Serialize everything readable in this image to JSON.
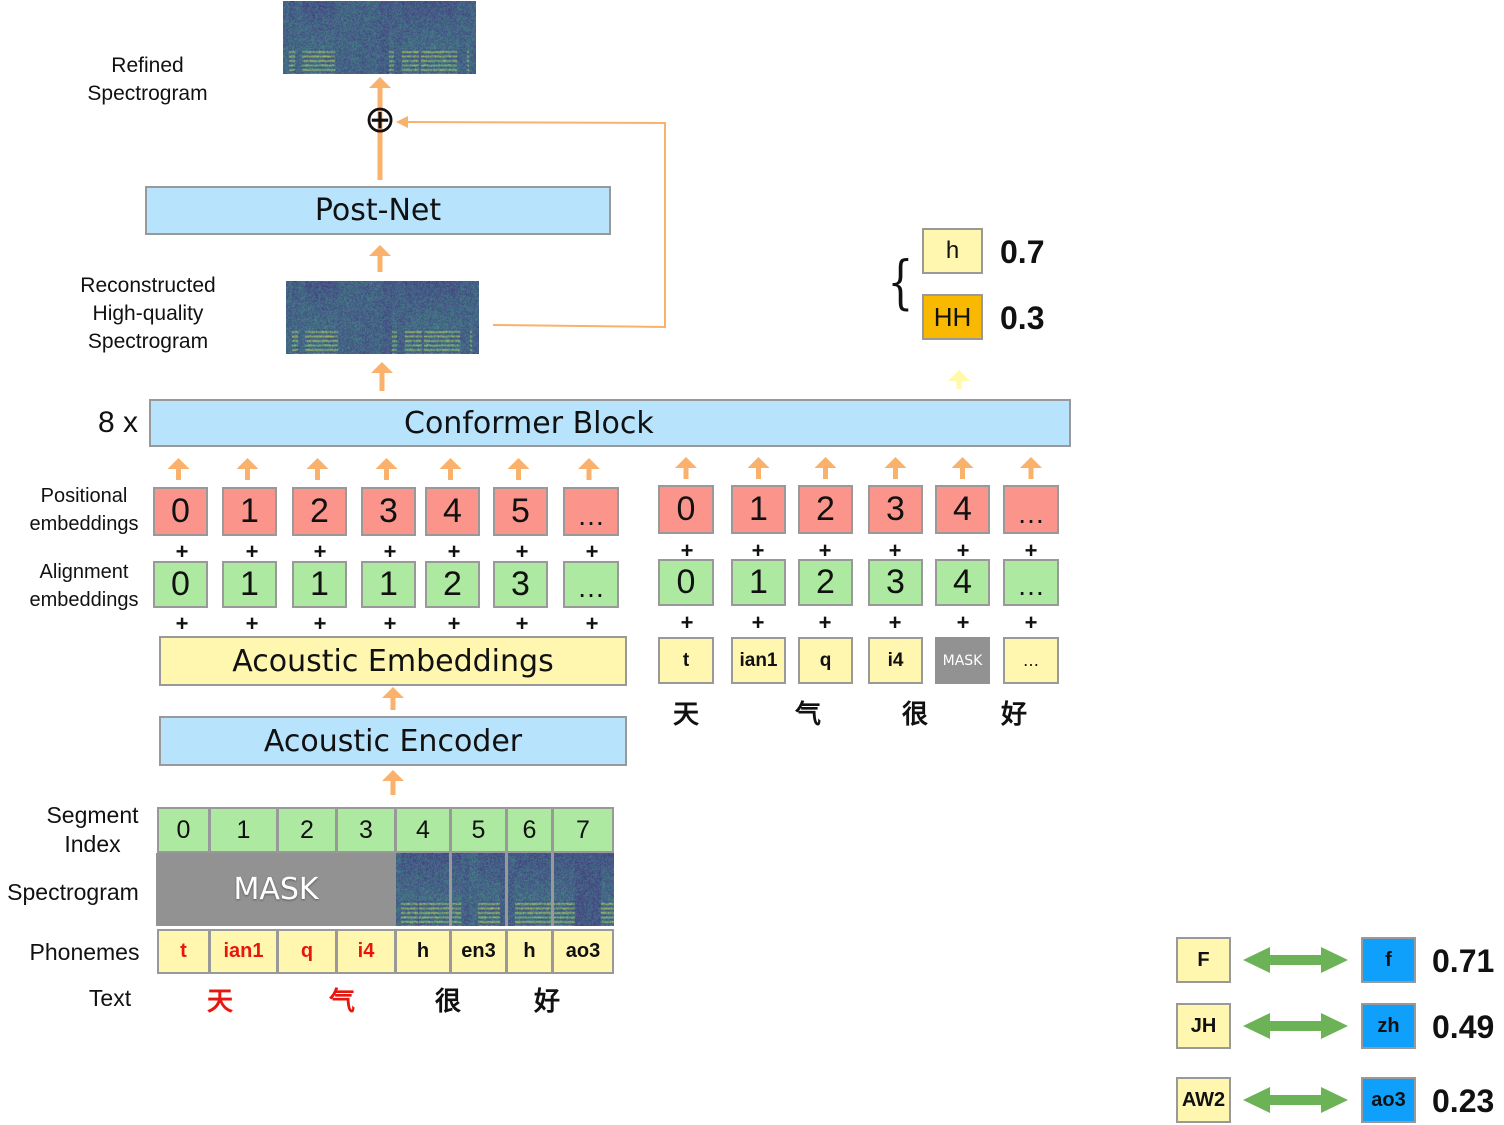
{
  "labels": {
    "refined_spectrogram": "Refined\nSpectrogram",
    "reconstructed_spectrogram": "Reconstructed\nHigh-quality\nSpectrogram",
    "repeat": "8 x",
    "positional_embeddings": "Positional\nembeddings",
    "alignment_embeddings": "Alignment\nembeddings",
    "segment_index": "Segment\nIndex",
    "spectrogram": "Spectrogram",
    "phonemes": "Phonemes",
    "text": "Text"
  },
  "blocks": {
    "post_net": "Post-Net",
    "conformer": "Conformer Block",
    "acoustic_embeddings": "Acoustic Embeddings",
    "acoustic_encoder": "Acoustic Encoder",
    "sum_symbol": "⊕"
  },
  "acoustic_branch": {
    "positional": [
      "0",
      "1",
      "2",
      "3",
      "4",
      "5",
      "…"
    ],
    "alignment": [
      "0",
      "1",
      "1",
      "1",
      "2",
      "3",
      "…"
    ]
  },
  "text_branch": {
    "positional": [
      "0",
      "1",
      "2",
      "3",
      "4",
      "…"
    ],
    "alignment": [
      "0",
      "1",
      "2",
      "3",
      "4",
      "…"
    ],
    "tokens": [
      "t",
      "ian1",
      "q",
      "i4",
      "MASK",
      "…"
    ],
    "characters": [
      "天",
      "气",
      "很",
      "好"
    ]
  },
  "prediction": {
    "candidates": [
      {
        "token": "h",
        "prob": "0.7"
      },
      {
        "token": "HH",
        "prob": "0.3"
      }
    ]
  },
  "input": {
    "segment_index": [
      "0",
      "1",
      "2",
      "3",
      "4",
      "5",
      "6",
      "7"
    ],
    "mask_label": "MASK",
    "phonemes": [
      {
        "text": "t",
        "masked": true
      },
      {
        "text": "ian1",
        "masked": true
      },
      {
        "text": "q",
        "masked": true
      },
      {
        "text": "i4",
        "masked": true
      },
      {
        "text": "h",
        "masked": false
      },
      {
        "text": "en3",
        "masked": false
      },
      {
        "text": "h",
        "masked": false
      },
      {
        "text": "ao3",
        "masked": false
      }
    ],
    "characters": [
      {
        "text": "天",
        "masked": true
      },
      {
        "text": "气",
        "masked": true
      },
      {
        "text": "很",
        "masked": false
      },
      {
        "text": "好",
        "masked": false
      }
    ]
  },
  "phoneme_mapping": [
    {
      "source": "F",
      "target": "f",
      "score": "0.71"
    },
    {
      "source": "JH",
      "target": "zh",
      "score": "0.49"
    },
    {
      "source": "AW2",
      "target": "ao3",
      "score": "0.23"
    }
  ],
  "colors": {
    "arrow": "#f9b16c",
    "masked_text": "#e8160e",
    "map_arrow": "#6bb356"
  }
}
